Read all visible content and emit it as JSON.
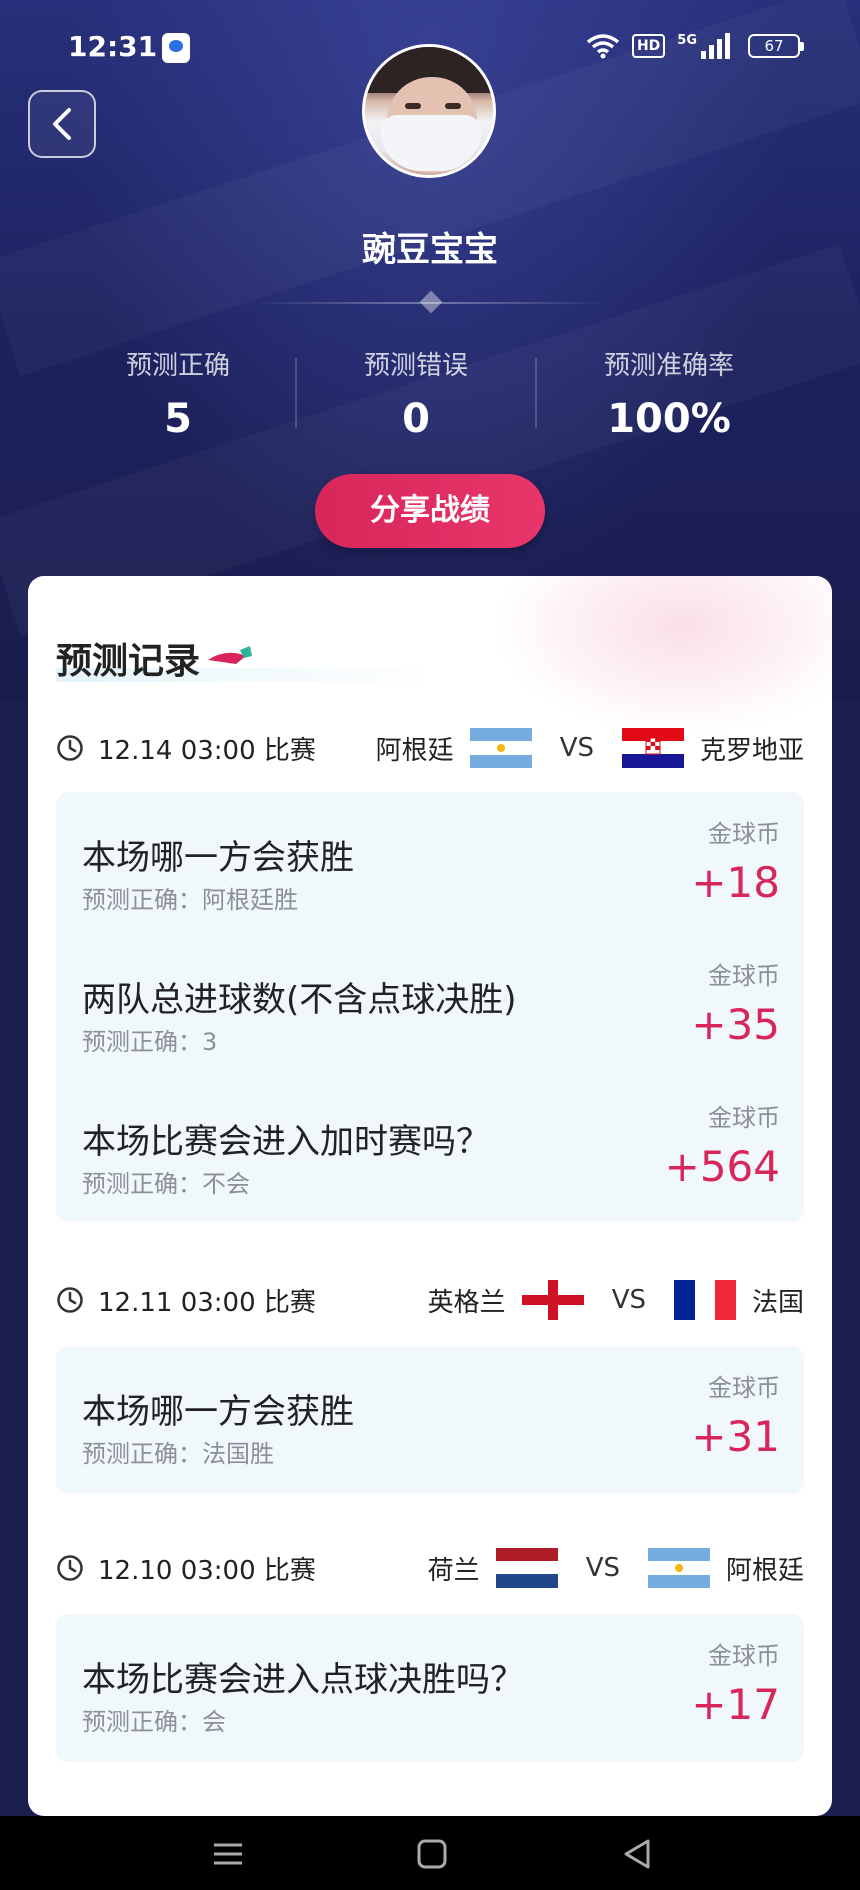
{
  "status_bar": {
    "time": "12:31",
    "network": "5G",
    "hd": "HD",
    "battery": "67"
  },
  "profile": {
    "username": "豌豆宝宝"
  },
  "stats": [
    {
      "label": "预测正确",
      "value": "5"
    },
    {
      "label": "预测错误",
      "value": "0"
    },
    {
      "label": "预测准确率",
      "value": "100%"
    }
  ],
  "share_button": "分享战绩",
  "records": {
    "title": "预测记录",
    "vs": "VS",
    "coin_label": "金球币",
    "matches": [
      {
        "time": "12.14 03:00 比赛",
        "home": "阿根廷",
        "away": "克罗地亚",
        "predictions": [
          {
            "question": "本场哪一方会获胜",
            "answer": "预测正确：阿根廷胜",
            "coins": "+18"
          },
          {
            "question": "两队总进球数(不含点球决胜)",
            "answer": "预测正确：3",
            "coins": "+35"
          },
          {
            "question": "本场比赛会进入加时赛吗？",
            "answer": "预测正确：不会",
            "coins": "+564"
          }
        ]
      },
      {
        "time": "12.11 03:00 比赛",
        "home": "英格兰",
        "away": "法国",
        "predictions": [
          {
            "question": "本场哪一方会获胜",
            "answer": "预测正确：法国胜",
            "coins": "+31"
          }
        ]
      },
      {
        "time": "12.10 03:00 比赛",
        "home": "荷兰",
        "away": "阿根廷",
        "predictions": [
          {
            "question": "本场比赛会进入点球决胜吗？",
            "answer": "预测正确：会",
            "coins": "+17"
          }
        ]
      }
    ]
  },
  "colors": {
    "accent": "#d8265b",
    "header_bg": "#1d2260",
    "card_bg": "#f1f8fc"
  }
}
